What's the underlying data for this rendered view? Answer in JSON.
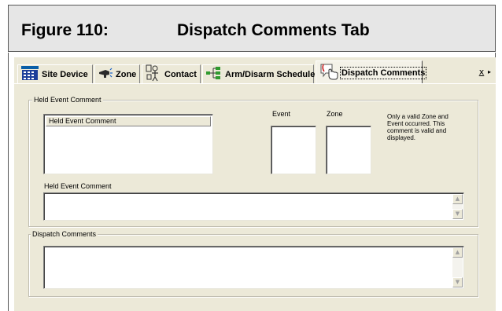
{
  "figure": {
    "number": "Figure 110:",
    "title": "Dispatch Comments Tab"
  },
  "tabs": [
    {
      "label": "Site Device",
      "icon": "site-device-icon",
      "active": false
    },
    {
      "label": "Zone",
      "icon": "zone-icon",
      "active": false
    },
    {
      "label": "Contact",
      "icon": "contact-icon",
      "active": false
    },
    {
      "label": "Arm/Disarm Schedule",
      "icon": "schedule-icon",
      "active": false
    },
    {
      "label": "Dispatch Comments",
      "icon": "dispatch-comments-icon",
      "active": true
    }
  ],
  "tab_scroll": {
    "left": "x",
    "right": "▸"
  },
  "held_event_group": {
    "legend": "Held Event Comment",
    "list_header": "Held Event Comment",
    "event_label": "Event",
    "zone_label": "Zone",
    "note": "Only a valid Zone and Event occurred. This comment is valid and displayed.",
    "comment_label": "Held Event Comment",
    "comment_value": ""
  },
  "dispatch_group": {
    "legend": "Dispatch Comments",
    "comment_value": ""
  },
  "scroll_glyphs": {
    "up": "▲",
    "down": "▼"
  },
  "colors": {
    "dialog_bg": "#ece9d8",
    "field_bg": "#ffffff",
    "header_bg": "#e6e6e6"
  }
}
